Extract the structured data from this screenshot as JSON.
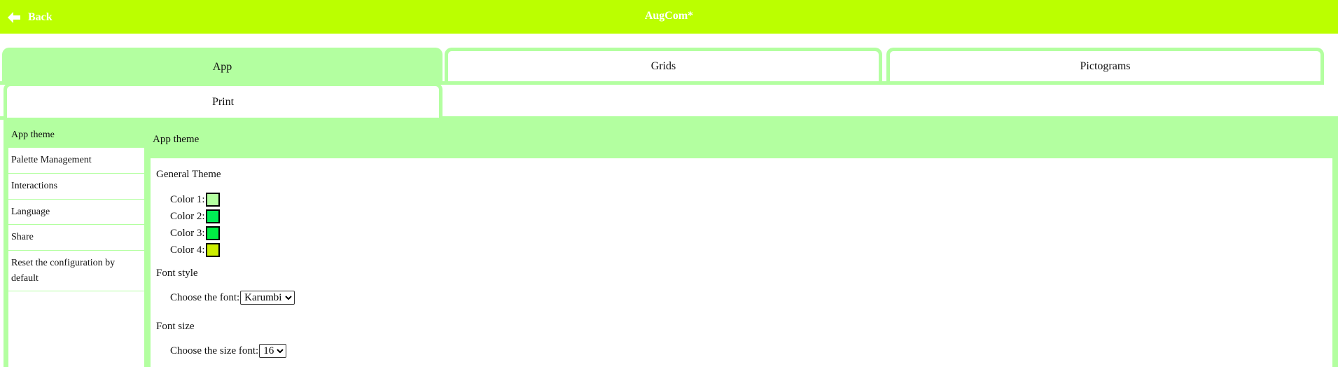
{
  "header": {
    "back_label": "Back",
    "title": "AugCom",
    "modified_marker": "*",
    "background_color": "#bbff00"
  },
  "tabs": [
    {
      "label": "App",
      "active": true
    },
    {
      "label": "Grids",
      "active": false
    },
    {
      "label": "Pictograms",
      "active": false
    },
    {
      "label": "Print",
      "active": false
    }
  ],
  "sidebar": {
    "items": [
      {
        "label": "App theme",
        "active": true
      },
      {
        "label": "Palette Management",
        "active": false
      },
      {
        "label": "Interactions",
        "active": false
      },
      {
        "label": "Language",
        "active": false
      },
      {
        "label": "Share",
        "active": false
      },
      {
        "label": "Reset the configuration by default",
        "active": false
      }
    ]
  },
  "content": {
    "header_title": "App theme",
    "general_theme": {
      "title": "General Theme",
      "colors": [
        {
          "label": "Color 1:",
          "value": "#b3ffa0"
        },
        {
          "label": "Color 2:",
          "value": "#00ee55"
        },
        {
          "label": "Color 3:",
          "value": "#00ee44"
        },
        {
          "label": "Color 4:",
          "value": "#ccee00"
        }
      ]
    },
    "font_style": {
      "title": "Font style",
      "label": "Choose the font:",
      "selected": "Karumbi"
    },
    "font_size": {
      "title": "Font size",
      "label": "Choose the size font:",
      "selected": "16"
    }
  },
  "theme": {
    "accent": "#b3ffa0"
  }
}
